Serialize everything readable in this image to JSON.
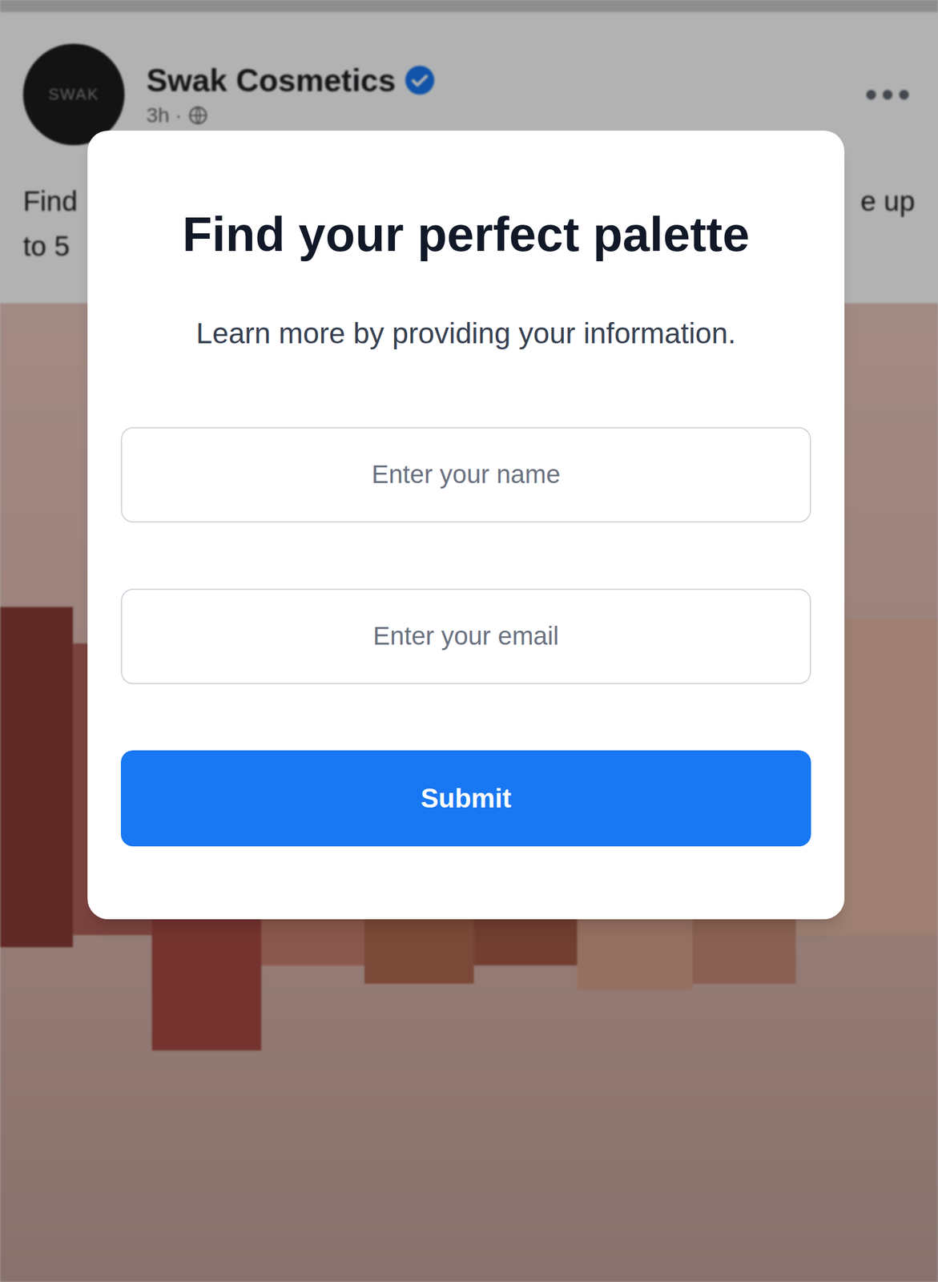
{
  "post": {
    "avatar_text": "SWAK",
    "author": "Swak Cosmetics",
    "verified": true,
    "meta": "3h ·",
    "text_lines": [
      {
        "left": "Find",
        "right": "e up"
      },
      {
        "left": "to 5"
      }
    ]
  },
  "form": {
    "title": "Find your perfect palette",
    "subtitle": "Learn more by providing your information.",
    "fields": [
      {
        "placeholder": "Enter your name"
      },
      {
        "placeholder": "Enter your email"
      }
    ],
    "submit": "Submit"
  }
}
